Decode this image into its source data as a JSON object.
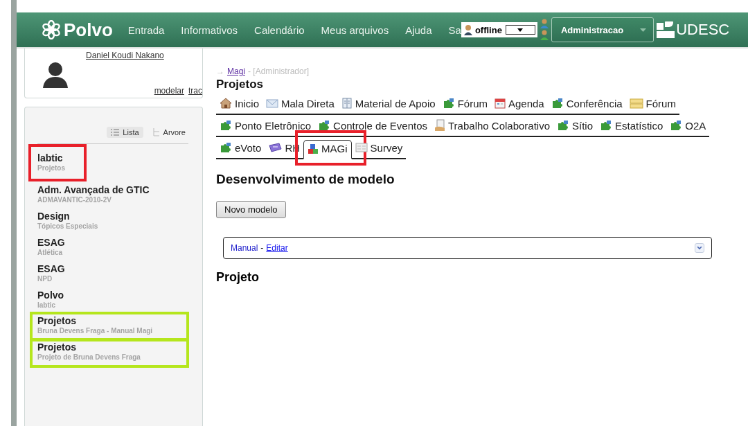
{
  "header": {
    "logo": "Polvo",
    "nav": [
      "Entrada",
      "Informativos",
      "Calendário",
      "Meus arquivos",
      "Ajuda",
      "Sa"
    ],
    "status": {
      "value": "offline"
    },
    "role_button": "Administracao",
    "brand": "UDESC"
  },
  "profile": {
    "name": "Daniel Koudi Nakano",
    "links": [
      "modelar",
      "trac"
    ]
  },
  "view_toggle": [
    {
      "label": "Lista",
      "kind": "list",
      "selected": true
    },
    {
      "label": "Arvore",
      "kind": "tree",
      "selected": false
    }
  ],
  "groups": [
    {
      "title": "labtic",
      "subtitle": "Projetos",
      "color": "#e8202a"
    },
    {
      "title": "Adm. Avançada de GTIC",
      "subtitle": "ADMAVANTIC-2010-2V"
    },
    {
      "title": "Design",
      "subtitle": "Tópicos Especiais"
    },
    {
      "title": "ESAG",
      "subtitle": "Atlética"
    },
    {
      "title": "ESAG",
      "subtitle": "NPD"
    },
    {
      "title": "Polvo",
      "subtitle": "labtic"
    },
    {
      "title": "Projetos",
      "subtitle": "Bruna Devens Fraga - Manual Magi",
      "color": "#b5e61d"
    },
    {
      "title": "Projetos",
      "subtitle": "Projeto de Bruna Devens Fraga",
      "color": "#b5e61d"
    }
  ],
  "breadcrumb": {
    "arrow": "→",
    "link": "Magi",
    "role": "- [Administrador]"
  },
  "title": "Projetos",
  "tab_rows": [
    [
      {
        "label": "Inicio",
        "kind": "home",
        "selected": false
      },
      {
        "label": "Mala Direta",
        "kind": "mail",
        "selected": false
      },
      {
        "label": "Material de Apoio",
        "kind": "book",
        "selected": false
      },
      {
        "label": "Fórum",
        "kind": "puzzle",
        "selected": false
      },
      {
        "label": "Agenda",
        "kind": "calendar",
        "selected": false
      },
      {
        "label": "Conferência",
        "kind": "puzzle",
        "selected": false
      },
      {
        "label": "Fórum",
        "kind": "forum",
        "selected": false
      }
    ],
    [
      {
        "label": "Ponto Eletrônico",
        "kind": "puzzle",
        "selected": false
      },
      {
        "label": "Controle de Eventos",
        "kind": "puzzle",
        "selected": false
      },
      {
        "label": "Trabalho Colaborativo",
        "kind": "document",
        "selected": false
      },
      {
        "label": "Sítio",
        "kind": "puzzle",
        "selected": false
      },
      {
        "label": "Estatístico",
        "kind": "puzzle",
        "selected": false
      },
      {
        "label": "O2A",
        "kind": "puzzle",
        "selected": false
      }
    ],
    [
      {
        "label": "eVoto",
        "kind": "puzzle",
        "selected": false
      },
      {
        "label": "RH",
        "kind": "ticket",
        "selected": false
      },
      {
        "label": "MAGi",
        "kind": "blocks",
        "selected": true,
        "color": "#e8202a"
      },
      {
        "label": "Survey",
        "kind": "form",
        "selected": false
      }
    ]
  ],
  "section_title": "Desenvolvimento de modelo",
  "new_button": "Novo modelo",
  "model_panel": {
    "name": "Manual",
    "separator": "-",
    "edit_link": "Editar",
    "expanded": false
  },
  "project_title": "Projeto"
}
